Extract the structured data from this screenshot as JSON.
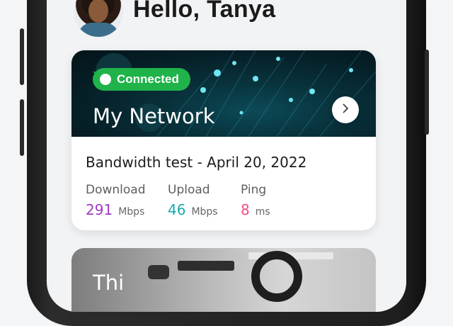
{
  "greeting": "Hello, Tanya",
  "network_card": {
    "status_badge": "Connected",
    "title": "My Network",
    "test_title": "Bandwidth test - April 20, 2022",
    "metrics": [
      {
        "label": "Download",
        "value": "291",
        "unit": "Mbps",
        "color": "#9c3bc4"
      },
      {
        "label": "Upload",
        "value": "46",
        "unit": "Mbps",
        "color": "#1aa7b3"
      },
      {
        "label": "Ping",
        "value": "8",
        "unit": "ms",
        "color": "#ec4f7e"
      }
    ]
  },
  "second_card": {
    "title": "Thi"
  },
  "colors": {
    "connected_badge": "#1fb34a"
  }
}
